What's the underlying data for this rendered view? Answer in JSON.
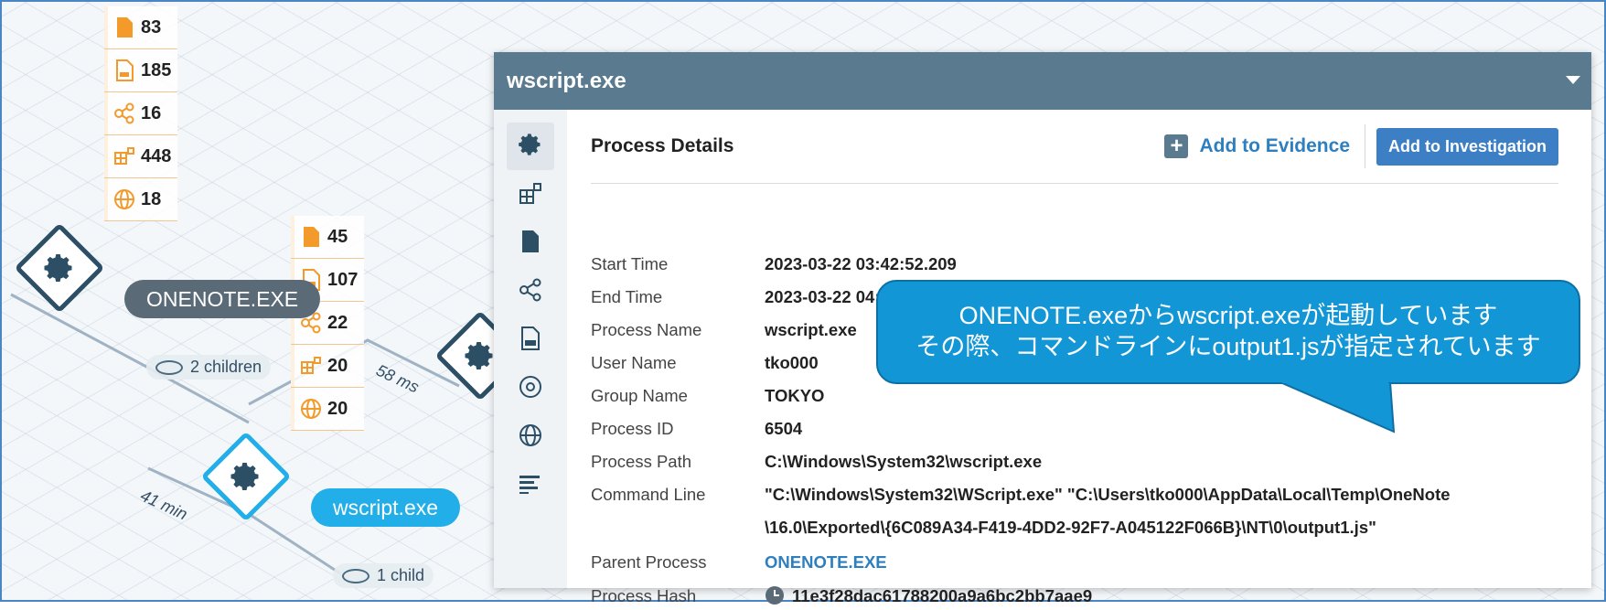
{
  "stats_top": [
    {
      "icon": "file-icon",
      "value": "83"
    },
    {
      "icon": "dll-file-icon",
      "value": "185"
    },
    {
      "icon": "network-icon",
      "value": "16"
    },
    {
      "icon": "registry-icon",
      "value": "448"
    },
    {
      "icon": "globe-icon",
      "value": "18"
    }
  ],
  "stats_mid": [
    {
      "icon": "file-icon",
      "value": "45"
    },
    {
      "icon": "dll-file-icon",
      "value": "107"
    },
    {
      "icon": "network-icon",
      "value": "22"
    },
    {
      "icon": "registry-icon",
      "value": "20"
    },
    {
      "icon": "globe-icon",
      "value": "20"
    }
  ],
  "graph": {
    "onenote_label": "ONENOTE.EXE",
    "wscript_label": "wscript.exe",
    "edge_children": "2 children",
    "edge_child": "1 child",
    "time_58": "58 ms",
    "time_41": "41 min"
  },
  "panel": {
    "title": "wscript.exe",
    "details_title": "Process Details",
    "add_evidence": "Add to Evidence",
    "add_investigation": "Add to Investigation",
    "fields": [
      {
        "label": "Start Time",
        "value": "2023-03-22 03:42:52.209"
      },
      {
        "label": "End Time",
        "value": "2023-03-22 04:24:09.000"
      },
      {
        "label": "Process Name",
        "value": "wscript.exe"
      },
      {
        "label": "User Name",
        "value": "tko000"
      },
      {
        "label": "Group Name",
        "value": "TOKYO"
      },
      {
        "label": "Process ID",
        "value": "6504"
      },
      {
        "label": "Process Path",
        "value": "C:\\Windows\\System32\\wscript.exe"
      }
    ],
    "command_line": {
      "label": "Command Line",
      "line1": "\"C:\\Windows\\System32\\WScript.exe\" \"C:\\Users\\tko000\\AppData\\Local\\Temp\\OneNote",
      "line2": "\\16.0\\Exported\\{6C089A34-F419-4DD2-92F7-A045122F066B}\\NT\\0\\output1.js\""
    },
    "parent": {
      "label": "Parent Process",
      "value": "ONENOTE.EXE"
    },
    "hash": {
      "label": "Process Hash",
      "value": "11e3f28dac61788200a9a6bc2bb7aae9"
    }
  },
  "callout": {
    "line1": "ONENOTE.exeからwscript.exeが起動しています",
    "line2": "その際、コマンドラインにoutput1.jsが指定されています"
  },
  "colors": {
    "accent": "#1296d6",
    "header": "#5a7a90",
    "orange": "#f39a2a",
    "link": "#2e7fbf"
  }
}
